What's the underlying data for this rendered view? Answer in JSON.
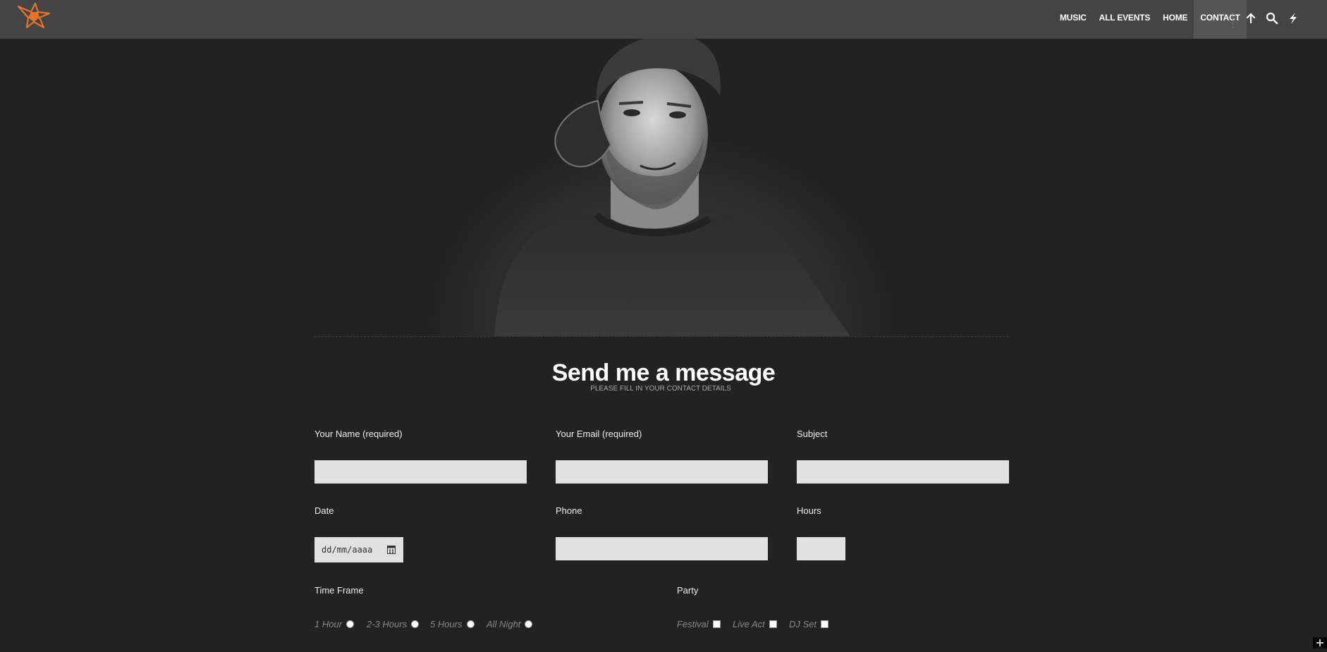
{
  "nav": {
    "items": [
      {
        "label": "MUSIC"
      },
      {
        "label": "ALL EVENTS"
      },
      {
        "label": "HOME"
      },
      {
        "label": "CONTACT",
        "active": true
      }
    ],
    "icons": [
      "arrow-up-icon",
      "search-icon",
      "lightning-icon"
    ],
    "accent_color": "#e8732a"
  },
  "heading": {
    "title": "Send me a message",
    "subtitle": "PLEASE FILL IN YOUR CONTACT DETAILS"
  },
  "form": {
    "name_label": "Your Name (required)",
    "email_label": "Your Email (required)",
    "subject_label": "Subject",
    "date_label": "Date",
    "date_placeholder": "dd/mm/aaaa",
    "phone_label": "Phone",
    "hours_label": "Hours",
    "timeframe_label": "Time Frame",
    "timeframe_options": [
      "1 Hour",
      "2-3 Hours",
      "5 Hours",
      "All Night"
    ],
    "party_label": "Party",
    "party_options": [
      "Festival",
      "Live Act",
      "DJ Set"
    ]
  }
}
